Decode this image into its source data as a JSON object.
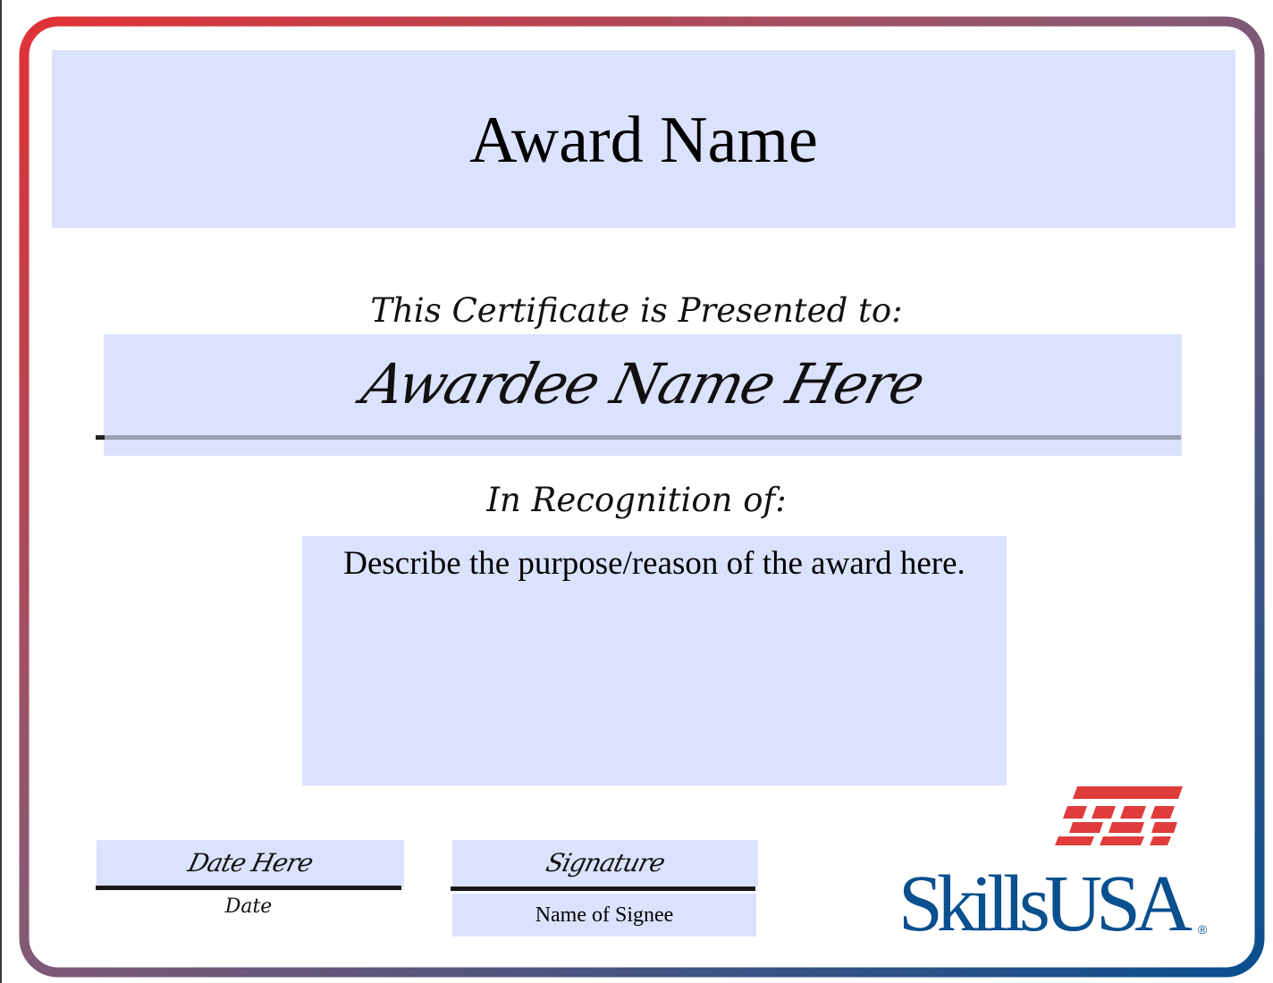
{
  "certificate": {
    "award_name": "Award Name",
    "presented_label": "This Certificate is Presented to:",
    "awardee_name": "Awardee Name Here",
    "recognition_label": "In Recognition of:",
    "purpose_text": "Describe the purpose/reason of the award here.",
    "date_value": "Date Here",
    "date_caption": "Date",
    "signature_value": "Signature",
    "signee_name": "Name of Signee"
  },
  "logo": {
    "wordmark": "SkillsUSA",
    "registered_mark": "®",
    "colors": {
      "wordmark": "#0a4f8e",
      "stripes": "#e03c3c"
    }
  },
  "colors": {
    "field_fill": "#dbe2fd",
    "border_gradient_start": "#e03236",
    "border_gradient_end": "#0a4f8e"
  }
}
